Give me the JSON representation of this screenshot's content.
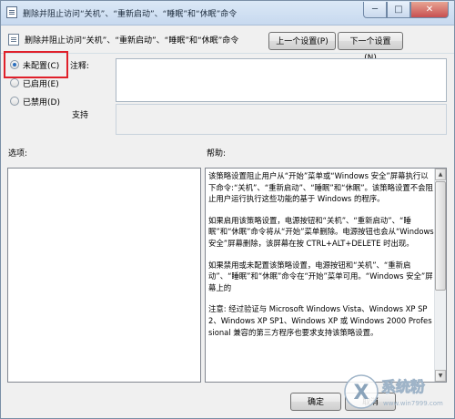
{
  "window": {
    "title": "删除并阻止访问“关机”、“重新启动”、“睡眠”和“休眠”命令",
    "controls": {
      "minimize": "─",
      "maximize": "□",
      "close": "✕"
    }
  },
  "header": {
    "title": "删除并阻止访问“关机”、“重新启动”、“睡眠”和“休眠”命令",
    "prev_button": "上一个设置(P)",
    "next_button": "下一个设置(N)"
  },
  "state": {
    "options": [
      {
        "label": "未配置(C)",
        "checked": true
      },
      {
        "label": "已启用(E)",
        "checked": false
      },
      {
        "label": "已禁用(D)",
        "checked": false
      }
    ]
  },
  "comment": {
    "label": "注释:",
    "value": ""
  },
  "support": {
    "label": "支持",
    "value": ""
  },
  "options_label": "选项:",
  "help_label": "帮助:",
  "help": {
    "paragraphs": [
      "该策略设置阻止用户从“开始”菜单或“Windows 安全”屏幕执行以下命令:“关机”、“重新启动”、“睡眠”和“休眠”。该策略设置不会阻止用户运行执行这些功能的基于 Windows 的程序。",
      "如果启用该策略设置，电源按钮和“关机”、“重新启动”、“睡眠”和“休眠”命令将从“开始”菜单删除。电源按钮也会从“Windows 安全”屏幕删除，该屏幕在按 CTRL+ALT+DELETE 时出现。",
      "如果禁用或未配置该策略设置，电源按钮和“关机”、“重新启动”、“睡眠”和“休眠”命令在“开始”菜单可用。“Windows 安全”屏幕上的",
      "注意: 经过验证与 Microsoft Windows Vista、Windows XP SP2、Windows XP SP1、Windows XP 或 Windows 2000 Professional 兼容的第三方程序也要求支持该策略设置。"
    ]
  },
  "footer": {
    "ok_button": "确定",
    "cancel_button": "取消"
  },
  "watermark": {
    "text": "系统粉",
    "sub": "www.win7999.com"
  },
  "colors": {
    "highlight": "#e0202a",
    "titlebar": "#c7d9ef",
    "accent": "#2b6fbf"
  }
}
